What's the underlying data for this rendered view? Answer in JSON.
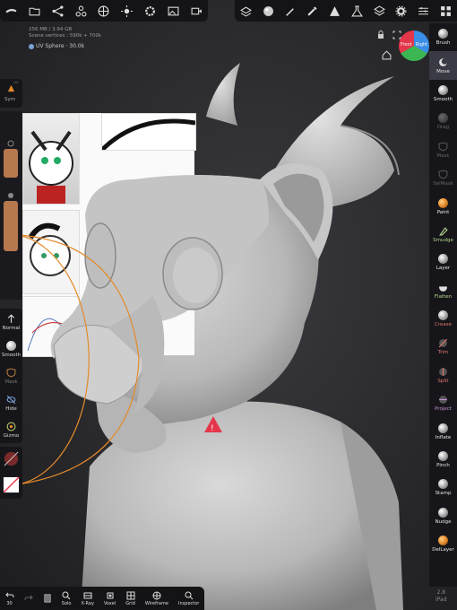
{
  "topbar_left": [
    "menu-icon",
    "folder-icon",
    "share-icon",
    "scene-icon",
    "globe-icon",
    "sun-icon",
    "settings-icon",
    "image-icon",
    "video-icon"
  ],
  "topbar_right": [
    "layers-icon",
    "material-icon",
    "pen-icon",
    "eyedropper-icon",
    "triangle-icon",
    "flask-icon",
    "stack-icon",
    "gear-icon",
    "sliders-icon",
    "grid-icon"
  ],
  "stats": {
    "memory": "256 MB / 3.94 GB",
    "vertices": "Scene vertices : 590k + 700k",
    "mesh": "UV Sphere · 30.0k"
  },
  "gizmo": {
    "front": "Front",
    "right": "Right"
  },
  "left_panel": {
    "sym_label": "Sym",
    "sym_small": "LM",
    "tools": [
      {
        "label": "Normal"
      },
      {
        "label": "Smooth"
      },
      {
        "label": "Mask"
      },
      {
        "label": "Hide"
      },
      {
        "label": "Gizmo"
      }
    ]
  },
  "right_tools": [
    {
      "label": "Brush"
    },
    {
      "label": "Move"
    },
    {
      "label": "Smooth"
    },
    {
      "label": "Drag"
    },
    {
      "label": "Mask"
    },
    {
      "label": "SelMask"
    },
    {
      "label": "Paint"
    },
    {
      "label": "Smudge"
    },
    {
      "label": "Layer"
    },
    {
      "label": "Flatten"
    },
    {
      "label": "Crease"
    },
    {
      "label": "Trim"
    },
    {
      "label": "Split"
    },
    {
      "label": "Project"
    },
    {
      "label": "Inflate"
    },
    {
      "label": "Pinch"
    },
    {
      "label": "Stamp"
    },
    {
      "label": "Nudge"
    },
    {
      "label": "DelLayer"
    }
  ],
  "bottom_tools": [
    {
      "label": "30"
    },
    {
      "label": ""
    },
    {
      "label": ""
    },
    {
      "label": "Solo"
    },
    {
      "label": "X-Ray"
    },
    {
      "label": "Voxel"
    },
    {
      "label": "Grid"
    },
    {
      "label": "Wireframe"
    },
    {
      "label": "Inspector"
    }
  ],
  "version": {
    "number": "2.8",
    "device": "iPad"
  },
  "colors": {
    "accent": "#e48a2a",
    "slider": "#b6784f",
    "panel": "#16161a",
    "selected": "#3a3a44",
    "warning": "#e4364b"
  }
}
